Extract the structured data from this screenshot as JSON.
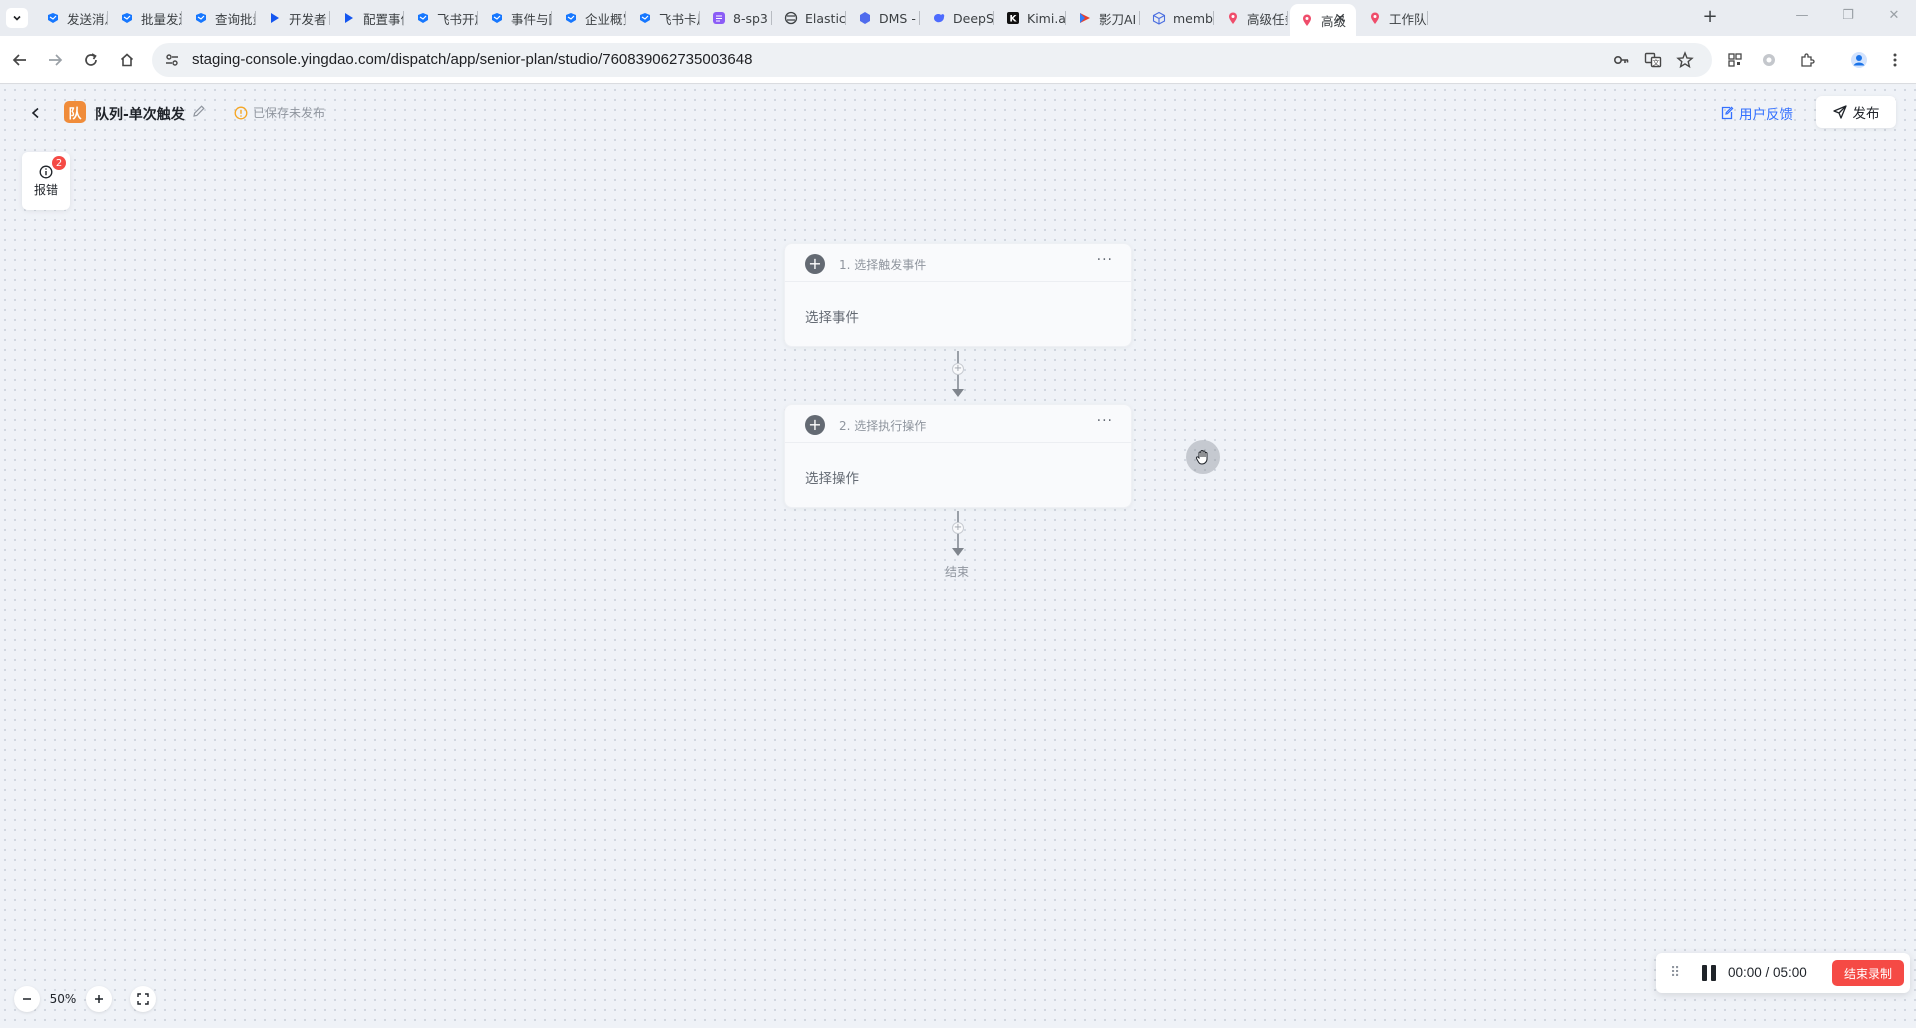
{
  "browser": {
    "tabs": [
      {
        "title": "发送消息",
        "icon": "yingdao-icon"
      },
      {
        "title": "批量发送",
        "icon": "yingdao-icon"
      },
      {
        "title": "查询批量",
        "icon": "yingdao-icon"
      },
      {
        "title": "开发者",
        "icon": "feishu-icon"
      },
      {
        "title": "配置事件",
        "icon": "feishu-icon"
      },
      {
        "title": "飞书开放",
        "icon": "yingdao-icon"
      },
      {
        "title": "事件与回",
        "icon": "yingdao-icon"
      },
      {
        "title": "企业概览",
        "icon": "yingdao-icon"
      },
      {
        "title": "飞书卡片",
        "icon": "yingdao-icon"
      },
      {
        "title": "8-sp3",
        "icon": "doc-icon"
      },
      {
        "title": "Elastic",
        "icon": "elastic-icon"
      },
      {
        "title": "DMS -",
        "icon": "dms-icon"
      },
      {
        "title": "DeepSeek",
        "icon": "deepseek-icon"
      },
      {
        "title": "Kimi.ai",
        "icon": "kimi-icon"
      },
      {
        "title": "影刀AI",
        "icon": "yingdao-ai-icon"
      },
      {
        "title": "member",
        "icon": "cube-icon"
      },
      {
        "title": "高级任务",
        "icon": "location-pin-icon"
      },
      {
        "title": "高级",
        "icon": "location-pin-icon",
        "active": true
      },
      {
        "title": "工作队列",
        "icon": "location-pin-icon"
      }
    ],
    "url": "staging-console.yingdao.com/dispatch/app/senior-plan/studio/760839062735003648"
  },
  "header": {
    "logo_text": "队",
    "title": "队列-单次触发",
    "save_status": "已保存未发布",
    "feedback_label": "用户反馈",
    "publish_label": "发布"
  },
  "error_panel": {
    "label": "报错",
    "count": "2"
  },
  "flow": {
    "steps": [
      {
        "title": "1. 选择触发事件",
        "body": "选择事件"
      },
      {
        "title": "2. 选择执行操作",
        "body": "选择操作"
      }
    ],
    "end_label": "结束"
  },
  "zoom": {
    "value": "50%"
  },
  "recorder": {
    "time": "00:00 / 05:00",
    "stop_label": "结束录制"
  },
  "colors": {
    "accent": "#3370ff",
    "logo": "#f08c3a",
    "danger": "#f54a45",
    "warning": "#f5a623"
  }
}
